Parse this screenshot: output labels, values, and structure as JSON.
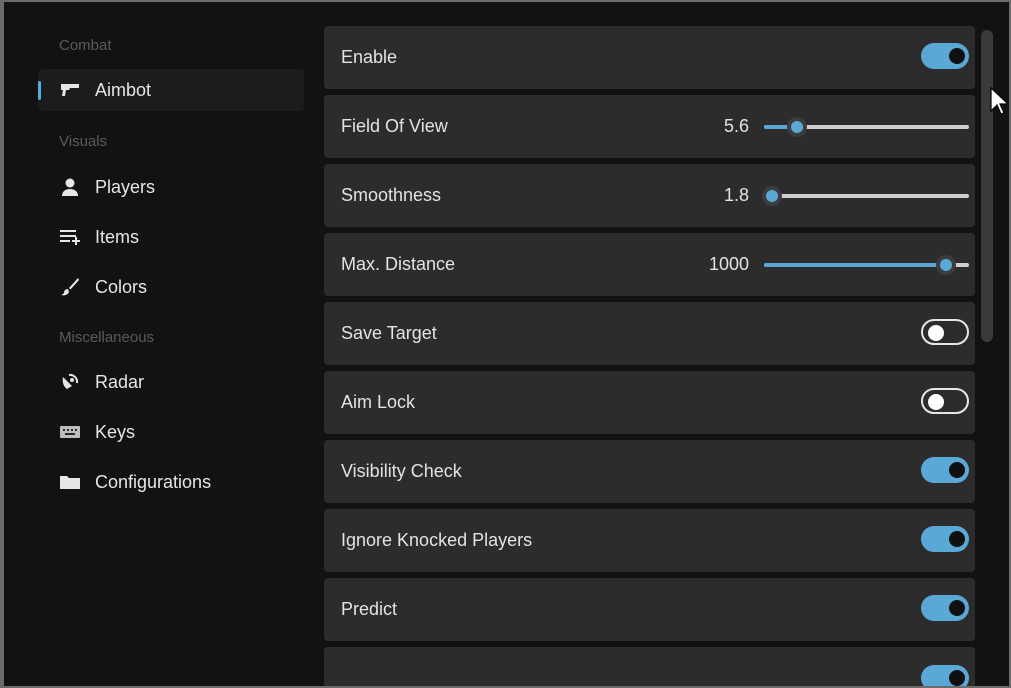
{
  "sidebar": {
    "sections": [
      {
        "title": "Combat",
        "items": [
          {
            "label": "Aimbot",
            "icon": "gun-icon",
            "active": true
          }
        ]
      },
      {
        "title": "Visuals",
        "items": [
          {
            "label": "Players",
            "icon": "person-icon"
          },
          {
            "label": "Items",
            "icon": "list-add-icon"
          },
          {
            "label": "Colors",
            "icon": "brush-icon"
          }
        ]
      },
      {
        "title": "Miscellaneous",
        "items": [
          {
            "label": "Radar",
            "icon": "radar-icon"
          },
          {
            "label": "Keys",
            "icon": "keyboard-icon"
          },
          {
            "label": "Configurations",
            "icon": "folder-icon"
          }
        ]
      }
    ]
  },
  "settings": {
    "enable": {
      "label": "Enable",
      "on": true
    },
    "fov": {
      "label": "Field Of View",
      "value": "5.6",
      "fraction": 0.16
    },
    "smoothness": {
      "label": "Smoothness",
      "value": "1.8",
      "fraction": 0.04
    },
    "max_distance": {
      "label": "Max. Distance",
      "value": "1000",
      "fraction": 0.89
    },
    "save_target": {
      "label": "Save Target",
      "on": false
    },
    "aim_lock": {
      "label": "Aim Lock",
      "on": false
    },
    "visibility_check": {
      "label": "Visibility Check",
      "on": true
    },
    "ignore_knocked": {
      "label": "Ignore Knocked Players",
      "on": true
    },
    "predict": {
      "label": "Predict",
      "on": true
    }
  },
  "colors": {
    "accent": "#5aa8d6",
    "row_bg": "#2c2c2c",
    "panel_bg": "#121212"
  }
}
